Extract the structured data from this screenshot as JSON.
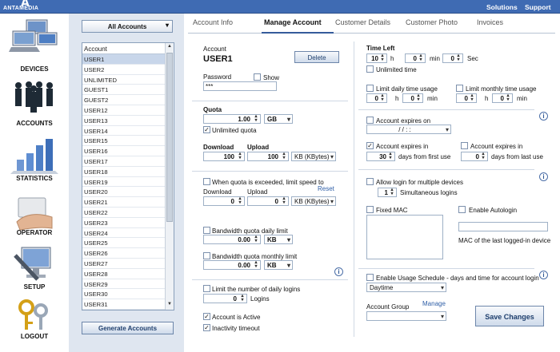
{
  "brand": {
    "logo_letter": "A",
    "logo_text": "ANTAMEDIA"
  },
  "top_links": [
    "Solutions",
    "Support"
  ],
  "nav": [
    {
      "label": "DEVICES",
      "icon": "devices-icon"
    },
    {
      "label": "ACCOUNTS",
      "icon": "accounts-icon"
    },
    {
      "label": "STATISTICS",
      "icon": "statistics-icon"
    },
    {
      "label": "OPERATOR",
      "icon": "operator-icon"
    },
    {
      "label": "SETUP",
      "icon": "setup-icon"
    },
    {
      "label": "LOGOUT",
      "icon": "logout-icon"
    }
  ],
  "accounts_filter": "All Accounts",
  "account_list": {
    "header": "Account",
    "items": [
      "USER1",
      "USER2",
      "UNLIMITED",
      "GUEST1",
      "GUEST2",
      "USER12",
      "USER13",
      "USER14",
      "USER15",
      "USER16",
      "USER17",
      "USER18",
      "USER19",
      "USER20",
      "USER21",
      "USER22",
      "USER23",
      "USER24",
      "USER25",
      "USER26",
      "USER27",
      "USER28",
      "USER29",
      "USER30",
      "USER31"
    ],
    "selected": "USER1"
  },
  "generate_button": "Generate Accounts",
  "tabs": [
    "Account Info",
    "Manage Account",
    "Customer Details",
    "Customer Photo",
    "Invoices"
  ],
  "account": {
    "label": "Account",
    "name": "USER1",
    "delete": "Delete",
    "password_label": "Password",
    "password_value": "***",
    "show_label": "Show"
  },
  "quota": {
    "label": "Quota",
    "value": "1.00",
    "unit": "GB",
    "unlimited_label": "Unlimited quota",
    "download_label": "Download",
    "upload_label": "Upload",
    "download_value": "100",
    "upload_value": "100",
    "speed_unit": "KB (KBytes)"
  },
  "limit_speed": {
    "label": "When quota is exceeded, limit speed to",
    "reset": "Reset",
    "download_label": "Download",
    "upload_label": "Upload",
    "download_value": "0",
    "upload_value": "0",
    "unit": "KB (KBytes)"
  },
  "bandwidth": {
    "daily_label": "Bandwidth quota daily limit",
    "daily_value": "0.00",
    "daily_unit": "KB",
    "monthly_label": "Bandwidth quota monthly limit",
    "monthly_value": "0.00",
    "monthly_unit": "KB"
  },
  "daily_logins": {
    "label": "Limit the number of daily logins",
    "value": "0",
    "suffix": "Logins"
  },
  "active": {
    "account_active": "Account is Active",
    "inactivity": "Inactivity timeout"
  },
  "time_left": {
    "label": "Time Left",
    "hours": "10",
    "h": "h",
    "minutes": "0",
    "min": "min",
    "seconds": "0",
    "sec": "Sec",
    "unlimited": "Unlimited time"
  },
  "usage": {
    "daily_label": "Limit daily time usage",
    "monthly_label": "Limit monthly time usage",
    "daily_h": "0",
    "daily_m": "0",
    "monthly_h": "0",
    "monthly_m": "0",
    "h": "h",
    "min": "min"
  },
  "expires": {
    "on_label": "Account expires on",
    "date": "/ /  : :",
    "in_label": "Account expires in",
    "in_value": "30",
    "in_suffix": "days from first use",
    "in2_label": "Account expires in",
    "in2_value": "0",
    "in2_suffix": "days from last use"
  },
  "multi": {
    "label": "Allow login for multiple devices",
    "value": "1",
    "suffix": "Simultaneous logins",
    "fixed_mac": "Fixed MAC",
    "autologin": "Enable Autologin",
    "mac_note": "MAC of the last logged-in device"
  },
  "schedule": {
    "label": "Enable Usage Schedule - days and time for account login",
    "value": "Daytime",
    "group_label": "Account Group",
    "manage": "Manage",
    "save": "Save Changes"
  }
}
